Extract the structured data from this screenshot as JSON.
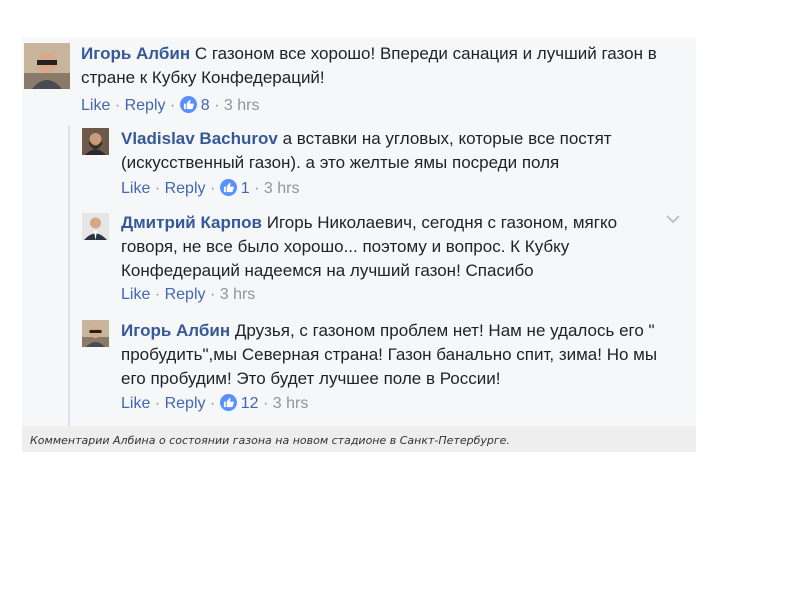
{
  "comments": [
    {
      "author": "Игорь Албин",
      "text": "С газоном все хорошо! Впереди санация и лучший газон в стране к Кубку Конфедераций!",
      "like": "Like",
      "reply": "Reply",
      "sep": "·",
      "reactions": "8",
      "time": "3 hrs"
    },
    {
      "author": "Vladislav Bachurov",
      "text": "а вставки на угловых, которые все постят (искусственный газон). а это желтые ямы посреди поля",
      "like": "Like",
      "reply": "Reply",
      "sep": "·",
      "reactions": "1",
      "time": "3 hrs"
    },
    {
      "author": "Дмитрий Карпов",
      "text": "Игорь Николаевич, сегодня с газоном, мягко говоря, не все было хорошо... поэтому и вопрос. К Кубку Конфедераций надеемся на лучший газон! Спасибо",
      "like": "Like",
      "reply": "Reply",
      "sep": "·",
      "time": "3 hrs"
    },
    {
      "author": "Игорь Албин",
      "text": "Друзья, с газоном проблем нет! Нам не удалось его \" пробудить\",мы Северная страна! Газон банально спит, зима! Но мы его пробудим! Это будет лучшее поле в России!",
      "like": "Like",
      "reply": "Reply",
      "sep": "·",
      "reactions": "12",
      "time": "3 hrs"
    }
  ],
  "caption": "Комментарии Албина о состоянии газона на новом стадионе в Санкт-Петербурге.",
  "colors": {
    "author": "#365899",
    "link": "#4267b2",
    "meta": "#90949c",
    "like_badge": "#5890ff",
    "panel": "#f6f7f9"
  }
}
